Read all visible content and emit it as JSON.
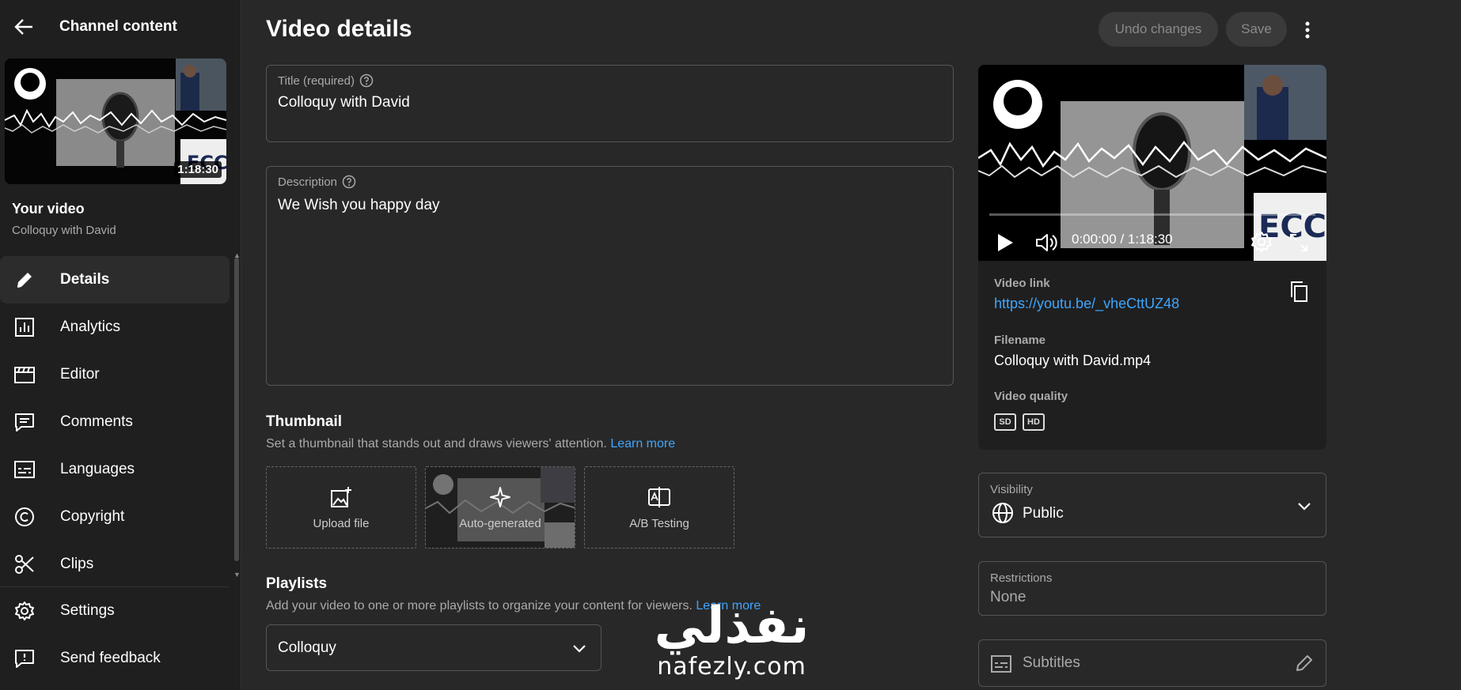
{
  "sidebar": {
    "title": "Channel content",
    "thumbnail_duration": "1:18:30",
    "your_video_label": "Your video",
    "video_name": "Colloquy with David",
    "nav": [
      {
        "label": "Details",
        "icon": "pencil-icon",
        "active": true
      },
      {
        "label": "Analytics",
        "icon": "analytics-icon"
      },
      {
        "label": "Editor",
        "icon": "editor-icon"
      },
      {
        "label": "Comments",
        "icon": "comments-icon"
      },
      {
        "label": "Languages",
        "icon": "languages-icon"
      },
      {
        "label": "Copyright",
        "icon": "copyright-icon"
      },
      {
        "label": "Clips",
        "icon": "scissors-icon"
      }
    ],
    "footer": [
      {
        "label": "Settings",
        "icon": "gear-icon"
      },
      {
        "label": "Send feedback",
        "icon": "feedback-icon"
      }
    ]
  },
  "header": {
    "title": "Video details",
    "undo_label": "Undo changes",
    "save_label": "Save"
  },
  "form": {
    "title_label": "Title (required)",
    "title_value": "Colloquy with David",
    "description_label": "Description",
    "description_value": "We Wish you happy day"
  },
  "thumbnail": {
    "heading": "Thumbnail",
    "desc": "Set a thumbnail that stands out and draws viewers' attention.",
    "learn_more": "Learn more",
    "options": [
      "Upload file",
      "Auto-generated",
      "A/B Testing"
    ]
  },
  "playlists": {
    "heading": "Playlists",
    "desc": "Add your video to one or more playlists to organize your content for viewers.",
    "learn_more": "Learn more",
    "selected": "Colloquy"
  },
  "player": {
    "time": "0:00:00 / 1:18:30"
  },
  "video_info": {
    "link_label": "Video link",
    "link": "https://youtu.be/_vheCttUZ48",
    "filename_label": "Filename",
    "filename": "Colloquy with David.mp4",
    "quality_label": "Video quality",
    "qualities": [
      "SD",
      "HD"
    ]
  },
  "visibility": {
    "label": "Visibility",
    "value": "Public"
  },
  "restrictions": {
    "label": "Restrictions",
    "value": "None"
  },
  "subtitles": {
    "placeholder": "Subtitles"
  },
  "watermark": {
    "arabic": "نفذلي",
    "latin": "nafezly.com"
  },
  "colors": {
    "accent_link": "#3ea6ff",
    "background": "#282828",
    "sidebar": "#1f1f1f"
  }
}
